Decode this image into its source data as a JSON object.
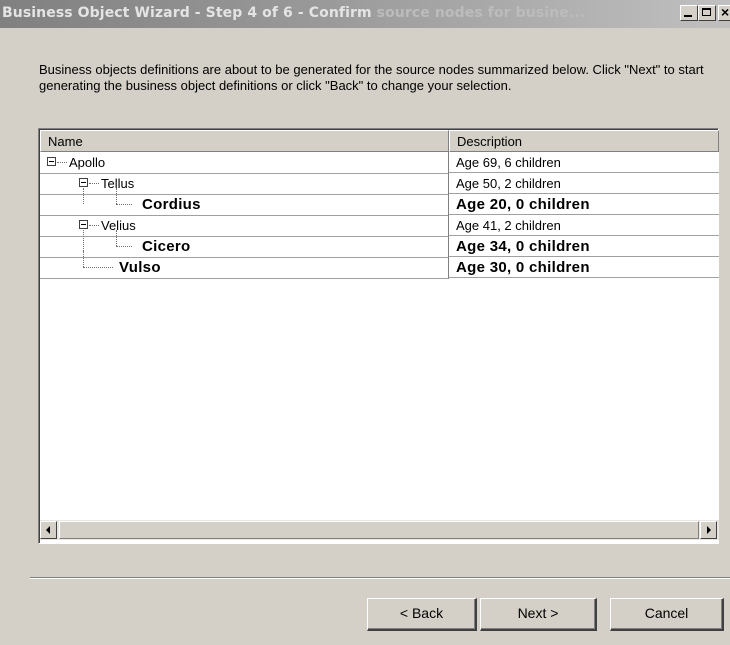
{
  "window": {
    "title_main": "Business Object Wizard - Step 4 of 6 - Confirm ",
    "title_tail": "source nodes for busine..."
  },
  "intro_text": "Business objects definitions are about to be generated for the source nodes summarized below. Click \"Next\" to start generating the business object definitions or click \"Back\" to change your selection.",
  "tree": {
    "columns": {
      "name": "Name",
      "description": "Description"
    },
    "rows": [
      {
        "name": "Apollo",
        "description": "Age 69, 6 children"
      },
      {
        "name": "Tellus",
        "description": "Age 50, 2 children"
      },
      {
        "name": "Cordius",
        "description": "Age 20, 0 children"
      },
      {
        "name": "Velius",
        "description": "Age 41, 2 children"
      },
      {
        "name": "Cicero",
        "description": "Age 34, 0 children"
      },
      {
        "name": "Vulso",
        "description": "Age 30, 0 children"
      }
    ]
  },
  "buttons": {
    "back": "< Back",
    "next": "Next >",
    "cancel": "Cancel"
  }
}
